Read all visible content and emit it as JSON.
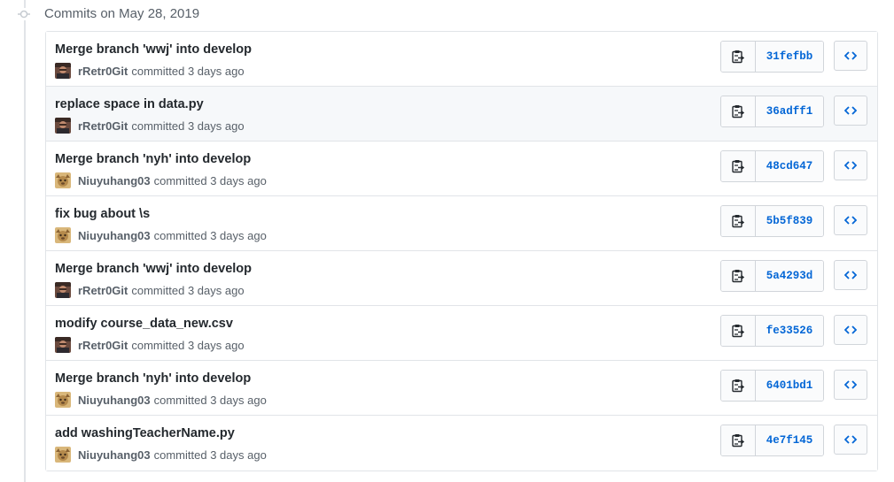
{
  "date_heading": "Commits on May 28, 2019",
  "icons": {
    "timeline": "commit-node-icon",
    "copy": "clipboard-icon",
    "browse": "code-icon"
  },
  "colors": {
    "link": "#0366d6",
    "text": "#24292e",
    "muted": "#586069",
    "border": "#e1e4e8"
  },
  "commits": [
    {
      "title": "Merge branch 'wwj' into develop",
      "author": "rRetr0Git",
      "action": "committed",
      "time": "3 days ago",
      "sha": "31fefbb",
      "avatar": "rretr0git"
    },
    {
      "title": "replace space in data.py",
      "author": "rRetr0Git",
      "action": "committed",
      "time": "3 days ago",
      "sha": "36adff1",
      "avatar": "rretr0git"
    },
    {
      "title": "Merge branch 'nyh' into develop",
      "author": "Niuyuhang03",
      "action": "committed",
      "time": "3 days ago",
      "sha": "48cd647",
      "avatar": "niuyuhang03"
    },
    {
      "title": "fix bug about \\s",
      "author": "Niuyuhang03",
      "action": "committed",
      "time": "3 days ago",
      "sha": "5b5f839",
      "avatar": "niuyuhang03"
    },
    {
      "title": "Merge branch 'wwj' into develop",
      "author": "rRetr0Git",
      "action": "committed",
      "time": "3 days ago",
      "sha": "5a4293d",
      "avatar": "rretr0git"
    },
    {
      "title": "modify course_data_new.csv",
      "author": "rRetr0Git",
      "action": "committed",
      "time": "3 days ago",
      "sha": "fe33526",
      "avatar": "rretr0git"
    },
    {
      "title": "Merge branch 'nyh' into develop",
      "author": "Niuyuhang03",
      "action": "committed",
      "time": "3 days ago",
      "sha": "6401bd1",
      "avatar": "niuyuhang03"
    },
    {
      "title": "add washingTeacherName.py",
      "author": "Niuyuhang03",
      "action": "committed",
      "time": "3 days ago",
      "sha": "4e7f145",
      "avatar": "niuyuhang03"
    }
  ]
}
